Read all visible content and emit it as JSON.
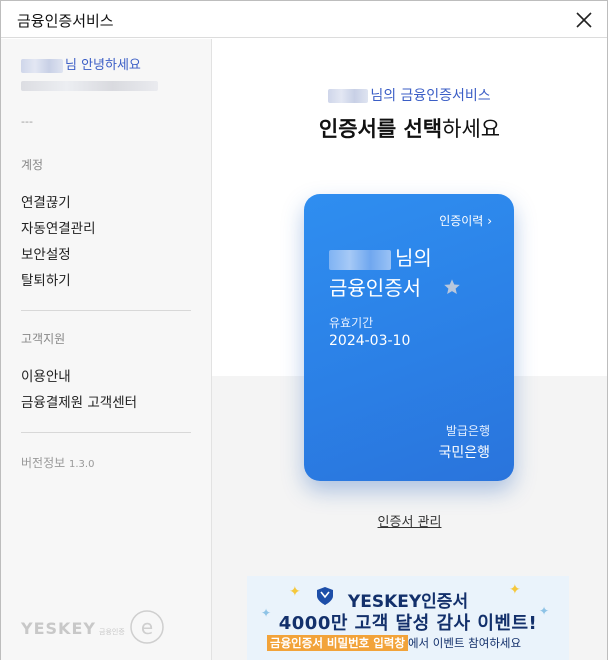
{
  "window": {
    "title": "금융인증서비스"
  },
  "sidebar": {
    "greeting_suffix": "님 안녕하세요",
    "dash": "---",
    "account_section": "계정",
    "account_items": [
      "연결끊기",
      "자동연결관리",
      "보안설정",
      "탈퇴하기"
    ],
    "support_section": "고객지원",
    "support_items": [
      "이용안내",
      "금융결제원 고객센터"
    ],
    "version_label": "버전정보",
    "version_number": "1.3.0",
    "logo_text": "YESKEY",
    "logo_sub": "금융인증"
  },
  "main": {
    "subtitle_suffix": "님의 금융인증서비스",
    "title_bold": "인증서를 선택",
    "title_rest": "하세요",
    "manage_link": "인증서 관리"
  },
  "card": {
    "history_link": "인증이력",
    "owner_suffix": "님의",
    "cert_name": "금융인증서",
    "valid_label": "유효기간",
    "valid_date": "2024-03-10",
    "bank_label": "발급은행",
    "bank_name": "국민은행"
  },
  "banner": {
    "line1": "YESKEY인증서",
    "line2": "4000만 고객 달성 감사 이벤트!",
    "line3_highlight": "금융인증서 비밀번호 입력창",
    "line3_rest": "에서 이벤트 참여하세요"
  },
  "colors": {
    "accent": "#3b5ec6",
    "card_blue": "#2b80e6",
    "banner_navy": "#13306b",
    "banner_orange": "#f2a33a"
  }
}
